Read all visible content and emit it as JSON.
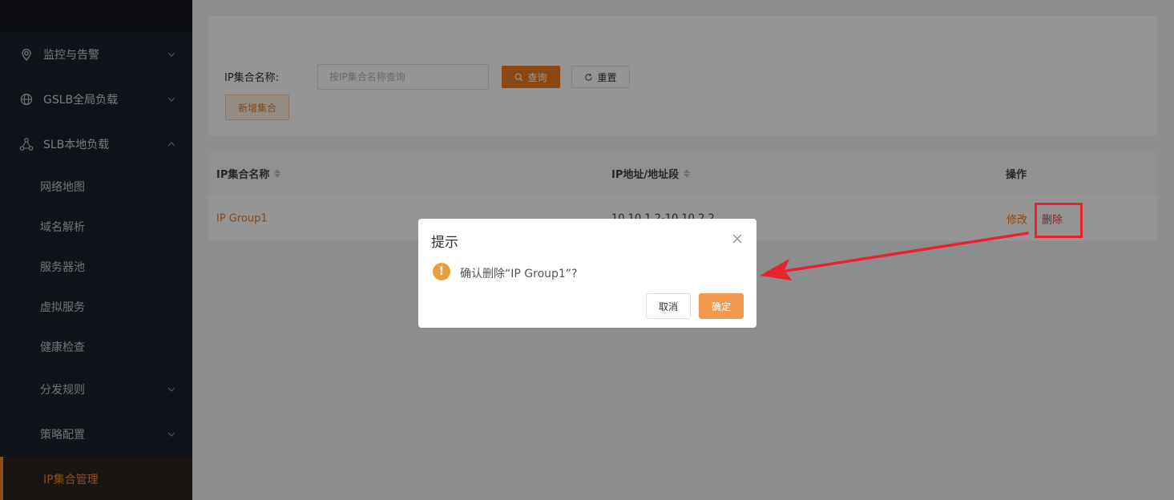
{
  "sidebar": {
    "groups": [
      {
        "label": "监控与告警",
        "icon": "location-pin-icon"
      },
      {
        "label": "GSLB全局负载",
        "icon": "globe-icon"
      },
      {
        "label": "SLB本地负载",
        "icon": "network-nodes-icon"
      }
    ],
    "items": [
      {
        "label": "网络地图"
      },
      {
        "label": "域名解析"
      },
      {
        "label": "服务器池"
      },
      {
        "label": "虚拟服务"
      },
      {
        "label": "健康检查"
      },
      {
        "label": "分发规则"
      },
      {
        "label": "策略配置"
      },
      {
        "label": "IP集合管理"
      }
    ]
  },
  "search": {
    "label": "IP集合名称:",
    "placeholder": "按IP集合名称查询",
    "query_label": "查询",
    "reset_label": "重置",
    "add_label": "新增集合"
  },
  "table": {
    "columns": [
      "IP集合名称",
      "IP地址/地址段",
      "操作"
    ],
    "rows": [
      {
        "name": "IP Group1",
        "address": "10.10.1.2-10.10.2.2",
        "edit": "修改",
        "delete": "删除"
      }
    ]
  },
  "dialog": {
    "title": "提示",
    "message": "确认删除“IP Group1”?",
    "cancel_label": "取消",
    "confirm_label": "确定"
  },
  "colors": {
    "accent": "#ee7a20",
    "sidebar_bg": "#1d222c",
    "annotation": "#e8232f"
  }
}
